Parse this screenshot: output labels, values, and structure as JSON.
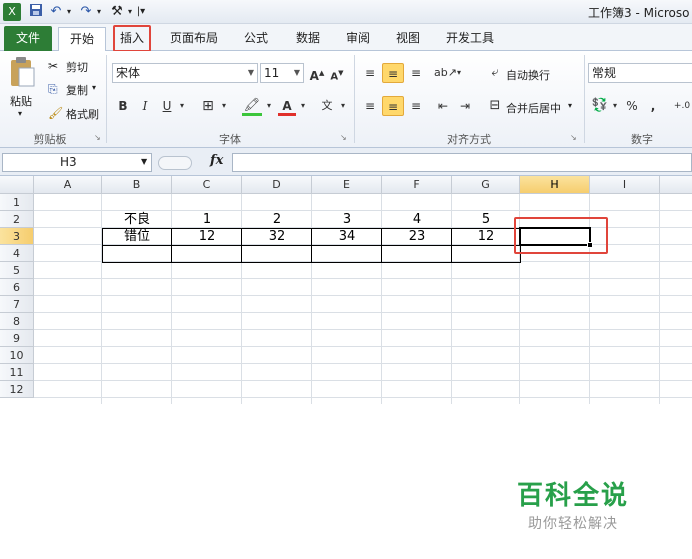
{
  "title": {
    "text": "工作簿3 - Microso"
  },
  "tabs": [
    {
      "label": "文件"
    },
    {
      "label": "开始"
    },
    {
      "label": "插入"
    },
    {
      "label": "页面布局"
    },
    {
      "label": "公式"
    },
    {
      "label": "数据"
    },
    {
      "label": "审阅"
    },
    {
      "label": "视图"
    },
    {
      "label": "开发工具"
    }
  ],
  "ribbon": {
    "clipboard": {
      "paste": "粘贴",
      "cut": "剪切",
      "copy": "复制",
      "format_painter": "格式刷",
      "label": "剪贴板"
    },
    "font": {
      "name": "宋体",
      "size": "11",
      "bold": "B",
      "italic": "I",
      "underline": "U",
      "label": "字体"
    },
    "alignment": {
      "wrap": "自动换行",
      "merge": "合并后居中",
      "label": "对齐方式"
    },
    "number": {
      "format": "常规",
      "percent": "%",
      "comma": ",",
      "label": "数字"
    }
  },
  "formula": {
    "cell_ref": "H3",
    "fx": "fx",
    "value": ""
  },
  "columns": [
    "A",
    "B",
    "C",
    "D",
    "E",
    "F",
    "G",
    "H",
    "I"
  ],
  "rows": [
    "1",
    "2",
    "3",
    "4",
    "5",
    "6",
    "7",
    "8",
    "9",
    "10",
    "11",
    "12"
  ],
  "table": {
    "row2": {
      "label": "不良",
      "values": [
        "1",
        "2",
        "3",
        "4",
        "5"
      ]
    },
    "row3": {
      "label": "错位",
      "values": [
        "12",
        "32",
        "34",
        "23",
        "12"
      ]
    }
  },
  "watermark": {
    "main": "百科全说",
    "sub": "助你轻松解决"
  },
  "colors": {
    "accent_file": "#2d7d36",
    "highlight": "#e0453b",
    "selected_header": "#f6cd6e"
  }
}
